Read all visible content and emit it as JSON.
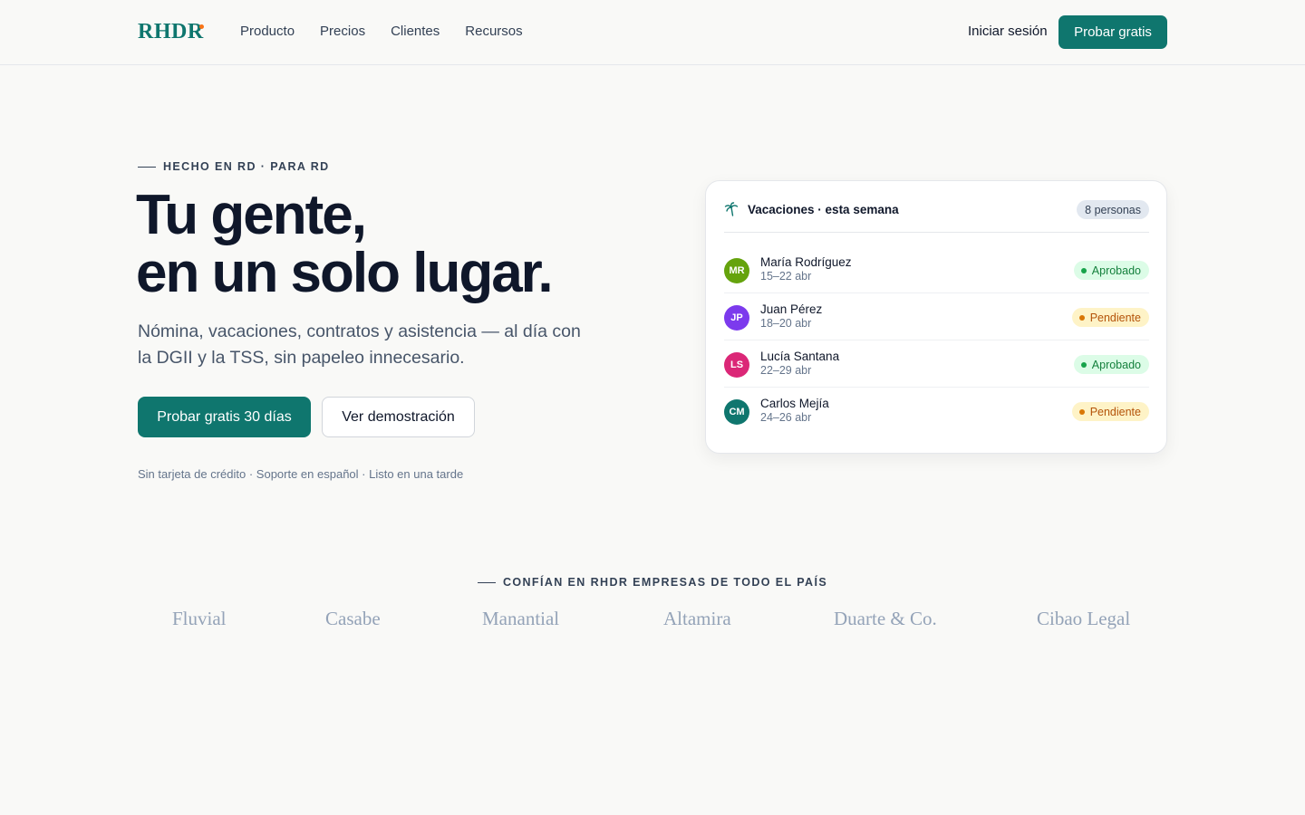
{
  "nav": {
    "logo": "RHDR",
    "links": [
      "Producto",
      "Precios",
      "Clientes",
      "Recursos"
    ],
    "login": "Iniciar sesión",
    "cta": "Probar gratis"
  },
  "hero": {
    "eyebrow": "HECHO EN RD · PARA RD",
    "headline_line1": "Tu gente,",
    "headline_line2": "en un solo lugar.",
    "subtitle": "Nómina, vacaciones, contratos y asistencia — al día con la DGII y la TSS, sin papeleo innecesario.",
    "primary_cta": "Probar gratis 30 días",
    "secondary_cta": "Ver demostración",
    "fine_print": "Sin tarjeta de crédito · Soporte en español · Listo en una tarde"
  },
  "vacations_card": {
    "icon": "palm-tree-icon",
    "title": "Vacaciones · esta semana",
    "count_badge": "8 personas",
    "rows": [
      {
        "initials": "MR",
        "name": "María Rodríguez",
        "dates": "15–22 abr",
        "status": "Aprobado",
        "avatar_color": "#65a30d"
      },
      {
        "initials": "JP",
        "name": "Juan Pérez",
        "dates": "18–20 abr",
        "status": "Pendiente",
        "avatar_color": "#7c3aed"
      },
      {
        "initials": "LS",
        "name": "Lucía Santana",
        "dates": "22–29 abr",
        "status": "Aprobado",
        "avatar_color": "#db2777"
      },
      {
        "initials": "CM",
        "name": "Carlos Mejía",
        "dates": "24–26 abr",
        "status": "Pendiente",
        "avatar_color": "#0f766e"
      }
    ]
  },
  "trust": {
    "label": "CONFÍAN EN RHDR EMPRESAS DE TODO EL PAÍS",
    "clients": [
      "Fluvial",
      "Casabe",
      "Manantial",
      "Altamira",
      "Duarte & Co.",
      "Cibao Legal"
    ]
  },
  "colors": {
    "brand": "#0f766e",
    "accent_dot": "#f97316",
    "approved_bg": "#dcfce7",
    "approved_text": "#15803d",
    "pending_bg": "#fef3c7",
    "pending_text": "#b45309"
  }
}
